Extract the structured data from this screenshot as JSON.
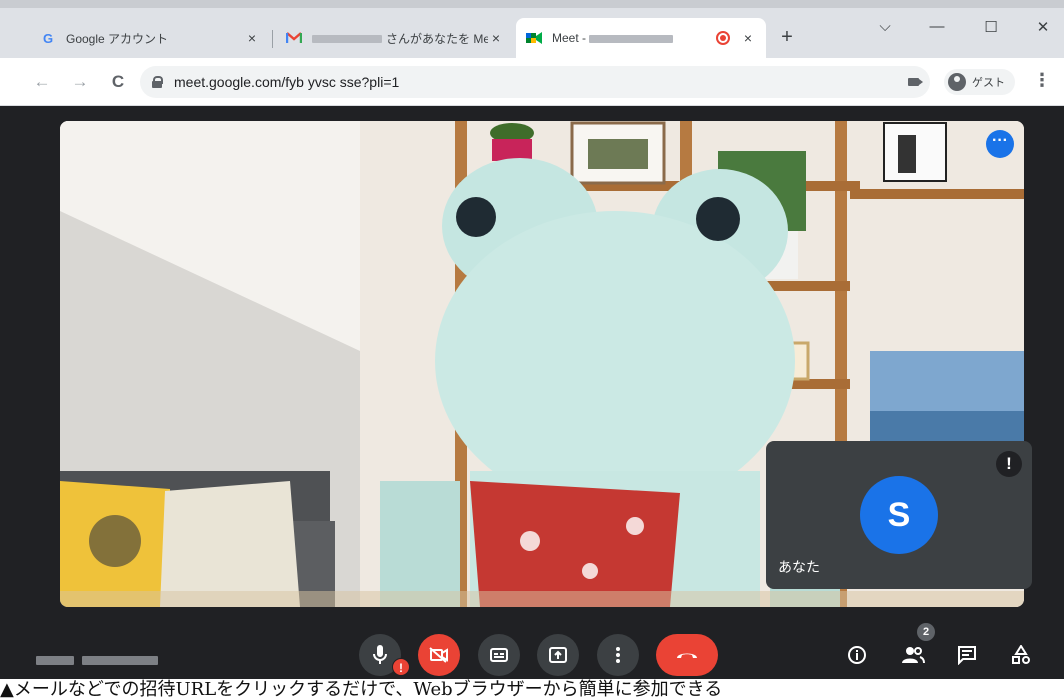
{
  "tabs": [
    {
      "title": "Google アカウント",
      "favicon": "google-g-icon",
      "close": "×"
    },
    {
      "title": "さんがあなたを Meet",
      "favicon": "gmail-icon",
      "close": "×"
    },
    {
      "title": "Meet -",
      "favicon": "meet-icon",
      "close": "×",
      "active": true
    }
  ],
  "window": {
    "new_tab": "+",
    "tab_search": "⌵",
    "minimize": "—",
    "maximize": "☐",
    "close": "✕"
  },
  "nav": {
    "back": "←",
    "forward": "→",
    "reload": "C"
  },
  "address": {
    "url": "meet.google.com/fyb yvsc sse?pli=1"
  },
  "profile": {
    "label": "ゲスト"
  },
  "menu": {
    "kebab": "⋮"
  },
  "meet": {
    "more_options": "···",
    "self_tile": {
      "initial": "S",
      "name": "あなた",
      "warning": "!"
    },
    "controls": {
      "mic_warning": "!",
      "participants_count": "2"
    }
  },
  "caption": "▲メールなどでの招待URLをクリックするだけで、Webブラウザーから簡単に参加できる",
  "colors": {
    "accent": "#1a73e8",
    "danger": "#ea4335",
    "bar": "#202124",
    "tile": "#3c4043"
  }
}
